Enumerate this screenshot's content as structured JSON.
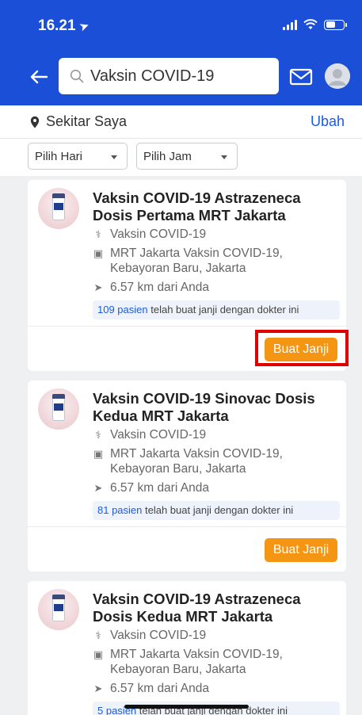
{
  "status_bar": {
    "time": "16.21"
  },
  "search": {
    "value": "Vaksin COVID-19"
  },
  "icons": {
    "back": "arrow-left-icon",
    "search": "magnifier-icon",
    "mail": "envelope-icon",
    "location": "map-pin-icon",
    "specialty": "stethoscope-icon",
    "hospital": "hospital-icon",
    "distance": "navigation-arrow-icon"
  },
  "location": {
    "label": "Sekitar Saya",
    "change_label": "Ubah"
  },
  "filters": {
    "day": "Pilih Hari",
    "time": "Pilih Jam"
  },
  "colors": {
    "header": "#1b4fd8",
    "accent": "#f59514",
    "link": "#1b5be0",
    "highlight": "#e00000"
  },
  "cards": [
    {
      "title": "Vaksin COVID-19 Astrazeneca Dosis Pertama MRT Jakarta",
      "specialty": "Vaksin COVID-19",
      "hospital": "MRT Jakarta Vaksin COVID-19, Kebayoran Baru, Jakarta",
      "distance": "6.57 km dari Anda",
      "patient_count": "109 pasien",
      "patient_text": " telah buat janji dengan dokter ini",
      "button": "Buat Janji"
    },
    {
      "title": "Vaksin COVID-19 Sinovac Dosis Kedua MRT Jakarta",
      "specialty": "Vaksin COVID-19",
      "hospital": "MRT Jakarta Vaksin COVID-19, Kebayoran Baru, Jakarta",
      "distance": "6.57 km dari Anda",
      "patient_count": "81 pasien",
      "patient_text": " telah buat janji dengan dokter ini",
      "button": "Buat Janji"
    },
    {
      "title": "Vaksin COVID-19 Astrazeneca Dosis Kedua MRT Jakarta",
      "specialty": "Vaksin COVID-19",
      "hospital": "MRT Jakarta Vaksin COVID-19, Kebayoran Baru, Jakarta",
      "distance": "6.57 km dari Anda",
      "patient_count": "5 pasien",
      "patient_text": " telah buat janji dengan dokter ini"
    }
  ]
}
